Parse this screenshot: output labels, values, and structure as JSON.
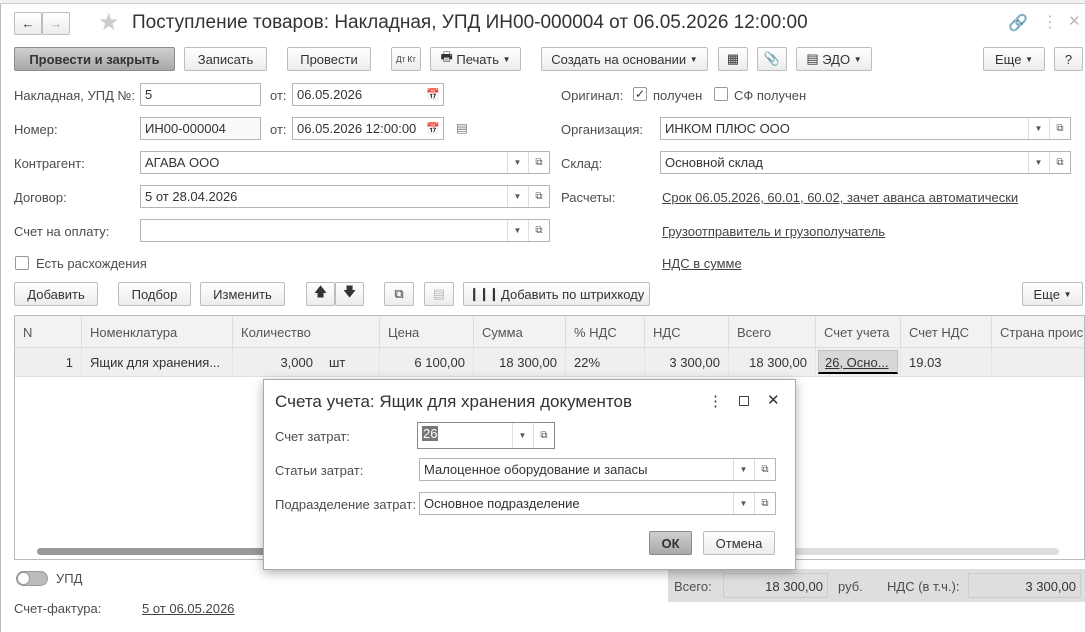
{
  "window": {
    "title": "Поступление товаров: Накладная, УПД ИН00-000004 от 06.05.2026 12:00:00"
  },
  "toolbar": {
    "post_close": "Провести и закрыть",
    "save": "Записать",
    "post": "Провести",
    "dtkt": "Дт Кт",
    "print": "Печать",
    "create_based": "Создать на основании",
    "edo": "ЭДО",
    "more": "Еще",
    "help": "?"
  },
  "form": {
    "invoice_label": "Накладная, УПД №:",
    "invoice_value": "5",
    "from1": "от:",
    "date1": "06.05.2026",
    "number_label": "Номер:",
    "number_value": "ИН00-000004",
    "from2": "от:",
    "date2": "06.05.2026 12:00:00",
    "contractor_label": "Контрагент:",
    "contractor_value": "АГАВА  ООО",
    "contract_label": "Договор:",
    "contract_value": "5 от 28.04.2026",
    "payment_label": "Счет на оплату:",
    "payment_value": "",
    "discrepancy_label": "Есть расхождения",
    "original_label": "Оригинал:",
    "received_label": "получен",
    "sf_received_label": "СФ получен",
    "org_label": "Организация:",
    "org_value": "ИНКОМ ПЛЮС ООО",
    "warehouse_label": "Склад:",
    "warehouse_value": "Основной склад",
    "settlements_label": "Расчеты:",
    "settlements_link": "Срок 06.05.2026, 60.01, 60.02, зачет аванса автоматически",
    "shipper_link": "Грузоотправитель и грузополучатель",
    "vat_link": "НДС в сумме"
  },
  "table_toolbar": {
    "add": "Добавить",
    "select": "Подбор",
    "change": "Изменить",
    "barcode": "Добавить по штрихкоду",
    "more": "Еще"
  },
  "table": {
    "columns": [
      "N",
      "Номенклатура",
      "Количество",
      "Цена",
      "Сумма",
      "% НДС",
      "НДС",
      "Всего",
      "Счет учета",
      "Счет НДС",
      "Страна проис"
    ],
    "rows": [
      {
        "n": "1",
        "item": "Ящик для хранения...",
        "qty": "3,000",
        "unit": "шт",
        "price": "6 100,00",
        "sum": "18 300,00",
        "vat_rate": "22%",
        "vat": "3 300,00",
        "total": "18 300,00",
        "account": "26, Осно...",
        "vat_account": "19.03",
        "country": ""
      }
    ]
  },
  "dialog": {
    "title": "Счета учета: Ящик для хранения документов",
    "cost_account_label": "Счет затрат:",
    "cost_account_value": "26",
    "cost_items_label": "Статьи затрат:",
    "cost_items_value": "Малоценное оборудование и запасы",
    "division_label": "Подразделение затрат:",
    "division_value": "Основное подразделение",
    "ok": "ОК",
    "cancel": "Отмена"
  },
  "footer": {
    "upd_label": "УПД",
    "sf_label": "Счет-фактура:",
    "sf_link": "5 от 06.05.2026",
    "total_label": "Всего:",
    "total_value": "18 300,00",
    "currency": "руб.",
    "vat_label": "НДС (в т.ч.):",
    "vat_value": "3 300,00"
  }
}
